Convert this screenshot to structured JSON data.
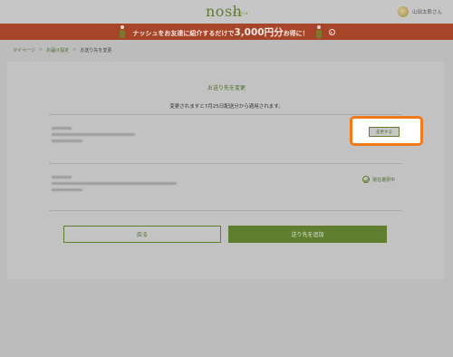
{
  "header": {
    "logo": "nosh",
    "logo_sub": "ナッシュ",
    "user_name": "山田太郎さん"
  },
  "banner": {
    "text_before": "ナッシュをお友達に紹介するだけで",
    "amount": "3,000円分",
    "text_after": "お得に！"
  },
  "breadcrumb": {
    "items": [
      "マイページ",
      "お届け設定"
    ],
    "separator": ">",
    "current": "お送り先を変更"
  },
  "main": {
    "title": "お送り先を変更",
    "notice": "変更されますと7月25日配送分から適用されます。",
    "change_button": "変更する",
    "current_label": "現在選択中",
    "back_button": "戻る",
    "add_button": "送り先を追加"
  },
  "colors": {
    "accent": "#5f7f2f",
    "banner": "#a6452a",
    "highlight": "#f07a1a"
  }
}
